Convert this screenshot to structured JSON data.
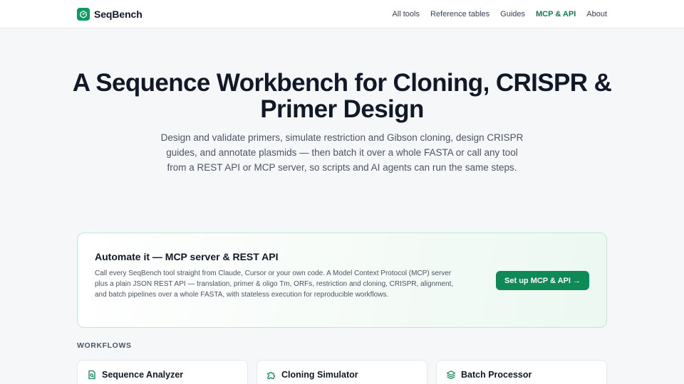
{
  "brand": {
    "name": "SeqBench",
    "icon": "leaf-logo-icon",
    "color": "#109a62"
  },
  "nav": [
    {
      "label": "All tools",
      "active": false
    },
    {
      "label": "Reference tables",
      "active": false
    },
    {
      "label": "Guides",
      "active": false
    },
    {
      "label": "MCP & API",
      "active": true
    },
    {
      "label": "About",
      "active": false
    }
  ],
  "hero": {
    "title": "A Sequence Workbench for Cloning, CRISPR & Primer Design",
    "description": "Design and validate primers, simulate restriction and Gibson cloning, design CRISPR guides, and annotate plasmids — then batch it over a whole FASTA or call any tool from a REST API or MCP server, so scripts and AI agents can run the same steps."
  },
  "automate": {
    "title": "Automate it — MCP server & REST API",
    "description": "Call every SeqBench tool straight from Claude, Cursor or your own code. A Model Context Protocol (MCP) server plus a plain JSON REST API — translation, primer & oligo Tm, ORFs, restriction and cloning, CRISPR, alignment, and batch pipelines over a whole FASTA, with stateless execution for reproducible workflows.",
    "button_label": "Set up MCP & API →"
  },
  "workflows": {
    "section_label": "WORKFLOWS",
    "cards": [
      {
        "title": "Sequence Analyzer",
        "icon": "document-search-icon"
      },
      {
        "title": "Cloning Simulator",
        "icon": "puzzle-icon"
      },
      {
        "title": "Batch Processor",
        "icon": "layers-icon"
      }
    ]
  },
  "colors": {
    "accent": "#0f8a57",
    "accent_text": "#0f7a4f",
    "card_border": "#bfe8d3"
  }
}
